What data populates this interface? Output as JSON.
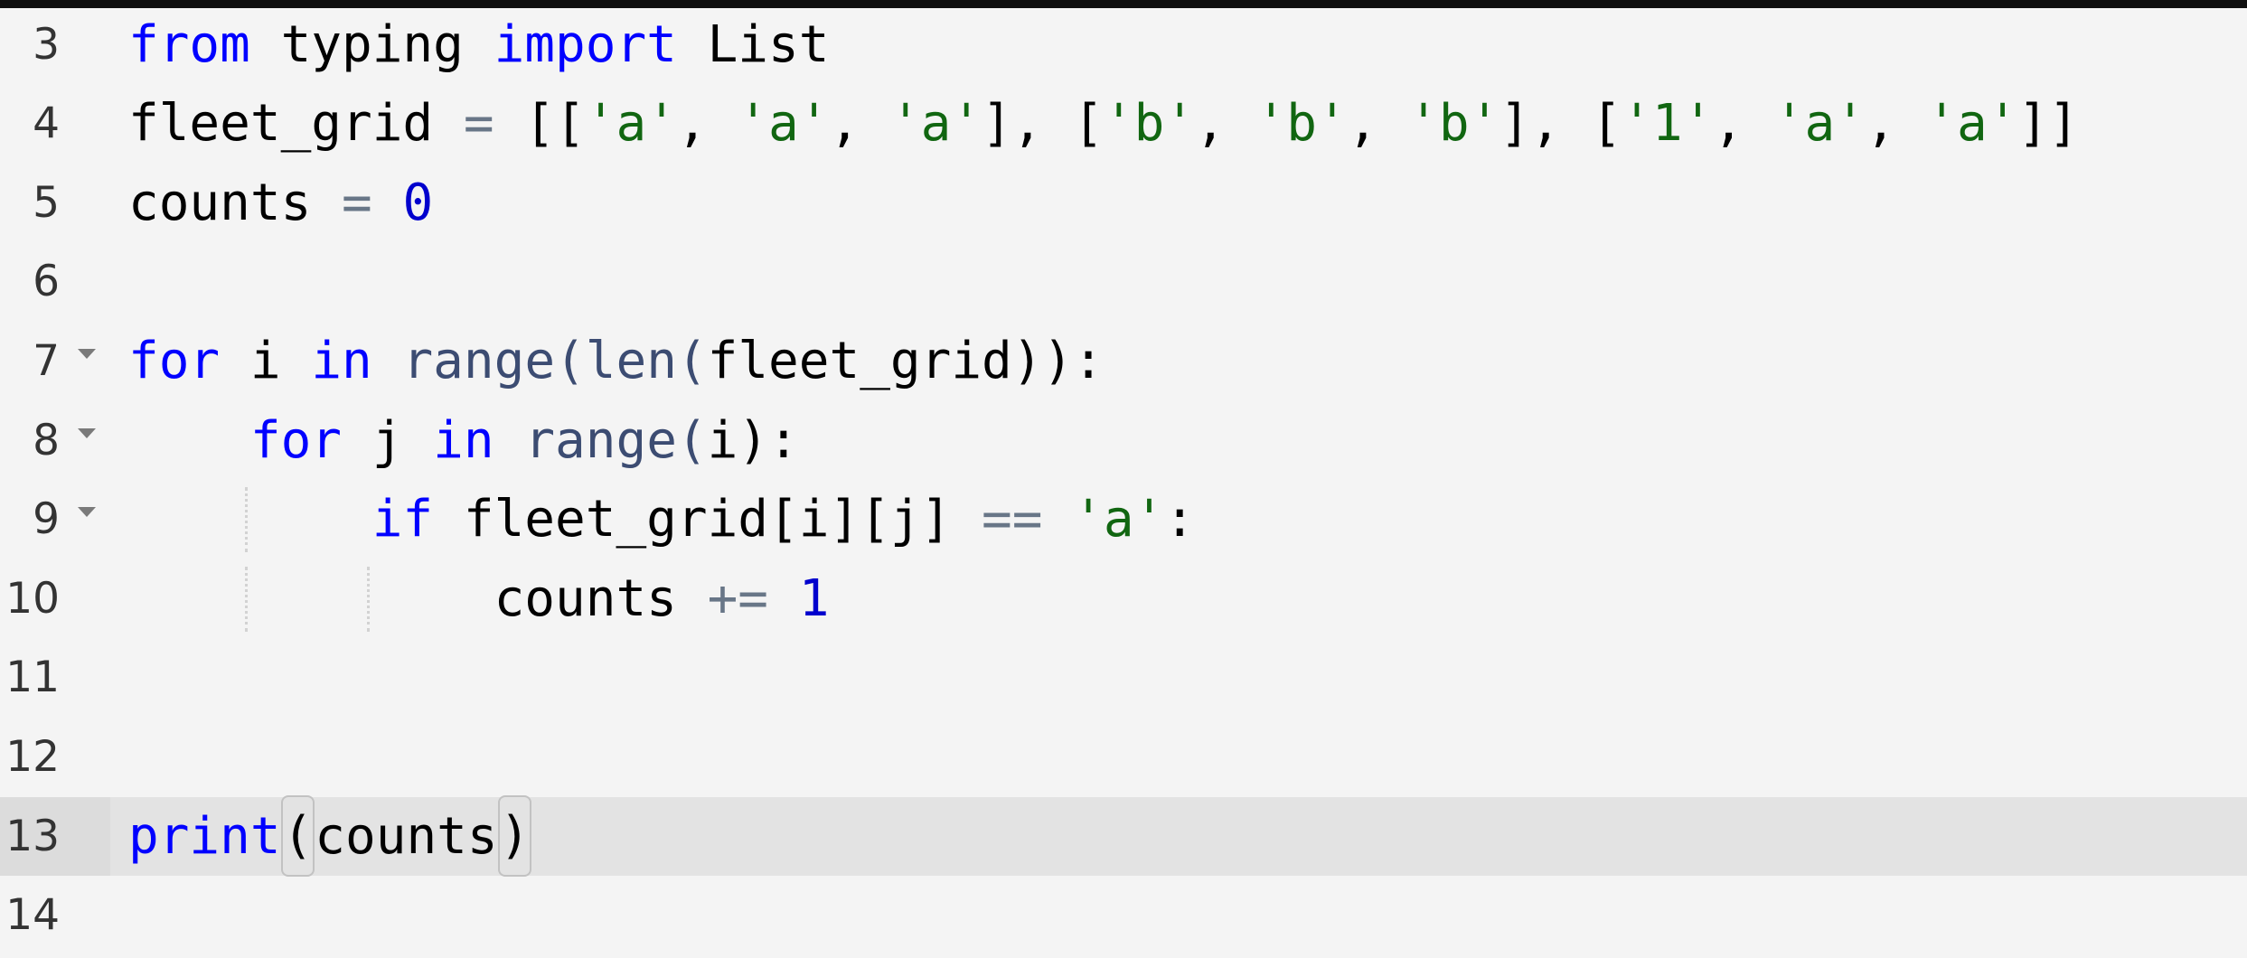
{
  "editor": {
    "language": "python",
    "active_line": 13,
    "colors": {
      "background": "#f4f4f4",
      "topbar": "#0f0f0f",
      "active_line": "#e3e3e3",
      "active_gutter": "#dcdcdc",
      "line_number": "#333333",
      "keyword": "#0000ff",
      "builtin": "#3c4c72",
      "operator": "#687687",
      "number": "#0000cd",
      "string": "#116611",
      "plain": "#000000"
    },
    "lines": [
      {
        "number": "3",
        "foldable": false,
        "indent_guides": [],
        "tokens": [
          {
            "text": "from",
            "type": "keyword"
          },
          {
            "text": " typing ",
            "type": "plain"
          },
          {
            "text": "import",
            "type": "keyword"
          },
          {
            "text": " List",
            "type": "plain"
          }
        ]
      },
      {
        "number": "4",
        "foldable": false,
        "indent_guides": [],
        "tokens": [
          {
            "text": "fleet_grid ",
            "type": "plain"
          },
          {
            "text": "=",
            "type": "operator"
          },
          {
            "text": " [[",
            "type": "plain"
          },
          {
            "text": "'a'",
            "type": "string"
          },
          {
            "text": ", ",
            "type": "plain"
          },
          {
            "text": "'a'",
            "type": "string"
          },
          {
            "text": ", ",
            "type": "plain"
          },
          {
            "text": "'a'",
            "type": "string"
          },
          {
            "text": "], [",
            "type": "plain"
          },
          {
            "text": "'b'",
            "type": "string"
          },
          {
            "text": ", ",
            "type": "plain"
          },
          {
            "text": "'b'",
            "type": "string"
          },
          {
            "text": ", ",
            "type": "plain"
          },
          {
            "text": "'b'",
            "type": "string"
          },
          {
            "text": "], [",
            "type": "plain"
          },
          {
            "text": "'1'",
            "type": "string"
          },
          {
            "text": ", ",
            "type": "plain"
          },
          {
            "text": "'a'",
            "type": "string"
          },
          {
            "text": ", ",
            "type": "plain"
          },
          {
            "text": "'a'",
            "type": "string"
          },
          {
            "text": "]]",
            "type": "plain"
          }
        ]
      },
      {
        "number": "5",
        "foldable": false,
        "indent_guides": [],
        "tokens": [
          {
            "text": "counts ",
            "type": "plain"
          },
          {
            "text": "=",
            "type": "operator"
          },
          {
            "text": " ",
            "type": "plain"
          },
          {
            "text": "0",
            "type": "number"
          }
        ]
      },
      {
        "number": "6",
        "foldable": false,
        "indent_guides": [],
        "tokens": []
      },
      {
        "number": "7",
        "foldable": true,
        "indent_guides": [],
        "tokens": [
          {
            "text": "for",
            "type": "keyword"
          },
          {
            "text": " i ",
            "type": "plain"
          },
          {
            "text": "in",
            "type": "keyword"
          },
          {
            "text": " ",
            "type": "plain"
          },
          {
            "text": "range(",
            "type": "builtin"
          },
          {
            "text": "len(",
            "type": "builtin"
          },
          {
            "text": "fleet_grid)):",
            "type": "plain"
          }
        ]
      },
      {
        "number": "8",
        "foldable": true,
        "indent_guides": [],
        "tokens": [
          {
            "text": "    ",
            "type": "plain"
          },
          {
            "text": "for",
            "type": "keyword"
          },
          {
            "text": " j ",
            "type": "plain"
          },
          {
            "text": "in",
            "type": "keyword"
          },
          {
            "text": " ",
            "type": "plain"
          },
          {
            "text": "range(",
            "type": "builtin"
          },
          {
            "text": "i):",
            "type": "plain"
          }
        ]
      },
      {
        "number": "9",
        "foldable": true,
        "indent_guides": [
          1
        ],
        "tokens": [
          {
            "text": "        ",
            "type": "plain"
          },
          {
            "text": "if",
            "type": "keyword"
          },
          {
            "text": " fleet_grid[i][j] ",
            "type": "plain"
          },
          {
            "text": "==",
            "type": "operator"
          },
          {
            "text": " ",
            "type": "plain"
          },
          {
            "text": "'a'",
            "type": "string"
          },
          {
            "text": ":",
            "type": "plain"
          }
        ]
      },
      {
        "number": "10",
        "foldable": false,
        "indent_guides": [
          1,
          2
        ],
        "tokens": [
          {
            "text": "            ",
            "type": "plain"
          },
          {
            "text": "counts ",
            "type": "plain"
          },
          {
            "text": "+=",
            "type": "operator"
          },
          {
            "text": " ",
            "type": "plain"
          },
          {
            "text": "1",
            "type": "number"
          }
        ]
      },
      {
        "number": "11",
        "foldable": false,
        "indent_guides": [],
        "tokens": []
      },
      {
        "number": "12",
        "foldable": false,
        "indent_guides": [],
        "tokens": []
      },
      {
        "number": "13",
        "foldable": false,
        "indent_guides": [],
        "tokens": [
          {
            "text": "print",
            "type": "keyword"
          },
          {
            "text": "(",
            "type": "plain",
            "bracket_match": true
          },
          {
            "text": "counts",
            "type": "plain"
          },
          {
            "text": ")",
            "type": "plain",
            "bracket_match": true
          }
        ]
      },
      {
        "number": "14",
        "foldable": false,
        "indent_guides": [],
        "tokens": []
      }
    ]
  }
}
